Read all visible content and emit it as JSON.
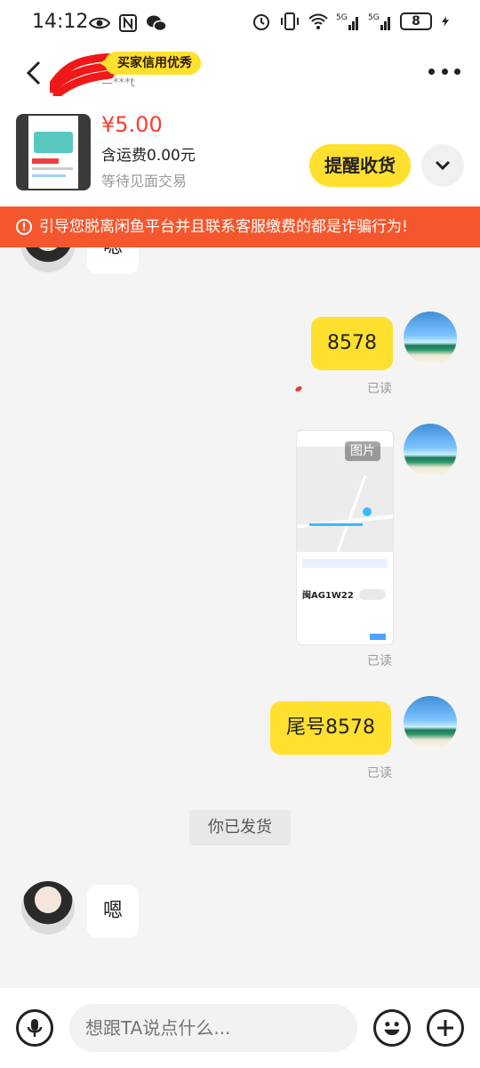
{
  "status_bar": {
    "time": "14:12",
    "battery_level": "8",
    "left_icons": [
      "eye-icon",
      "nfc-icon",
      "wechat-icon"
    ],
    "right_icons": [
      "alarm-icon",
      "vibrate-icon",
      "wifi-icon",
      "signal-5g-icon",
      "signal-5g-icon",
      "battery-icon",
      "charging-icon"
    ]
  },
  "header": {
    "credit_badge": "买家信用优秀",
    "seller_sub": "—***t"
  },
  "product": {
    "price": "¥5.00",
    "shipping": "含运费0.00元",
    "trade_status": "等待见面交易",
    "remind_button": "提醒收货"
  },
  "warning": {
    "text": "引导您脱离闲鱼平台并且联系客服缴费的都是诈骗行为!",
    "icon_text": "!"
  },
  "chat": {
    "messages": [
      {
        "from": "seller",
        "text": "嗯"
      },
      {
        "from": "me",
        "text": "8578",
        "status": "已读"
      },
      {
        "from": "me",
        "type": "image",
        "image_label": "图片",
        "plate_text": "闽AG1W22",
        "status": "已读"
      },
      {
        "from": "me",
        "text": "尾号8578",
        "status": "已读"
      },
      {
        "from": "system",
        "text": "你已发货"
      },
      {
        "from": "seller",
        "text": "嗯"
      }
    ]
  },
  "input": {
    "placeholder": "想跟TA说点什么..."
  },
  "colors": {
    "accent_yellow": "#ffe02e",
    "warning_orange": "#f4572e",
    "price_red": "#ff3b30"
  }
}
